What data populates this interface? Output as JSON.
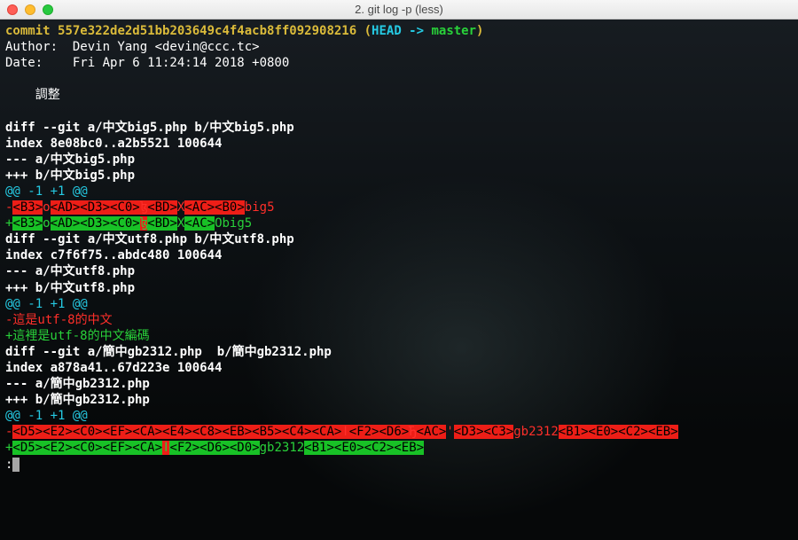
{
  "window": {
    "title": "2. git log -p (less)"
  },
  "colors": {
    "yellow": "#dbbb3a",
    "cyan": "#25cae3",
    "green": "#29d13a",
    "red": "#ff2f2a",
    "bg_red": "#ed1e17",
    "bg_green": "#18c126"
  },
  "commit": {
    "label": "commit ",
    "hash": "557e322de2d51bb203649c4f4acb8ff092908216",
    "ref_open": " (",
    "head": "HEAD -> ",
    "branch": "master",
    "ref_close": ")"
  },
  "author": "Author:  Devin Yang <devin@ccc.tc>",
  "date": "Date:    Fri Apr 6 11:24:14 2018 +0800",
  "message": "    調整",
  "diffs": [
    {
      "diff_line": "diff --git a/中文big5.php b/中文big5.php",
      "index_line": "index 8e08bc0..a2b5521 100644",
      "minus_file": "--- a/中文big5.php",
      "plus_file": "+++ b/中文big5.php",
      "hunk": "@@ -1 +1 @@",
      "removed": {
        "prefix": "-",
        "segs": [
          {
            "t": "<B3>",
            "fg": "black",
            "bg": "red"
          },
          {
            "t": "o",
            "fg": "red",
            "bg": ""
          },
          {
            "t": "<AD><D3><C0>",
            "fg": "black",
            "bg": "red"
          },
          {
            "t": "ɮ",
            "fg": "red",
            "bg": "red"
          },
          {
            "t": "<BD>",
            "fg": "black",
            "bg": "red"
          },
          {
            "t": "X",
            "fg": "red",
            "bg": ""
          },
          {
            "t": "<AC><B0>",
            "fg": "black",
            "bg": "red"
          },
          {
            "t": "big5",
            "fg": "red",
            "bg": ""
          }
        ]
      },
      "added": {
        "prefix": "+",
        "segs": [
          {
            "t": "<B3>",
            "fg": "black",
            "bg": "green"
          },
          {
            "t": "o",
            "fg": "green",
            "bg": ""
          },
          {
            "t": "<AD><D3><C0>",
            "fg": "black",
            "bg": "green"
          },
          {
            "t": "ɮ",
            "fg": "green",
            "bg": "red"
          },
          {
            "t": "<BD>",
            "fg": "black",
            "bg": "green"
          },
          {
            "t": "X",
            "fg": "green",
            "bg": ""
          },
          {
            "t": "<AC>",
            "fg": "black",
            "bg": "green"
          },
          {
            "t": "Obig5",
            "fg": "green",
            "bg": ""
          }
        ]
      }
    },
    {
      "diff_line": "diff --git a/中文utf8.php b/中文utf8.php",
      "index_line": "index c7f6f75..abdc480 100644",
      "minus_file": "--- a/中文utf8.php",
      "plus_file": "+++ b/中文utf8.php",
      "hunk": "@@ -1 +1 @@",
      "removed_plain": "-這是utf-8的中文",
      "added_plain": "+這裡是utf-8的中文編碼"
    },
    {
      "diff_line": "diff --git a/簡中gb2312.php  b/簡中gb2312.php",
      "index_line": "index a878a41..67d223e 100644",
      "minus_file": "--- a/簡中gb2312.php",
      "plus_file": "+++ b/簡中gb2312.php",
      "hunk": "@@ -1 +1 @@",
      "removed": {
        "prefix": "-",
        "segs": [
          {
            "t": "<D5><E2><C0><EF><CA><E4><C8><EB><B5><C4><CA>",
            "fg": "black",
            "bg": "red"
          },
          {
            "t": "ǀ",
            "fg": "red",
            "bg": "red"
          },
          {
            "t": "<F2><D6>",
            "fg": "black",
            "bg": "red"
          },
          {
            "t": "Ђ",
            "fg": "red",
            "bg": "red"
          },
          {
            "t": "<AC>",
            "fg": "black",
            "bg": "red"
          },
          {
            "t": "'",
            "fg": "red",
            "bg": ""
          },
          {
            "t": "<D3><C3>",
            "fg": "black",
            "bg": "red"
          },
          {
            "t": "gb2312",
            "fg": "red",
            "bg": ""
          },
          {
            "t": "<B1><E0><C2><EB>",
            "fg": "black",
            "bg": "red"
          }
        ]
      },
      "added": {
        "prefix": "+",
        "segs": [
          {
            "t": "<D5><E2><C0><EF><CA>",
            "fg": "black",
            "bg": "green"
          },
          {
            "t": "ǀ",
            "fg": "green",
            "bg": "red"
          },
          {
            "t": "<F2><D6><D0>",
            "fg": "black",
            "bg": "green"
          },
          {
            "t": "gb2312",
            "fg": "green",
            "bg": ""
          },
          {
            "t": "<B1><E0><C2><EB>",
            "fg": "black",
            "bg": "green"
          }
        ]
      }
    }
  ],
  "prompt": ":"
}
